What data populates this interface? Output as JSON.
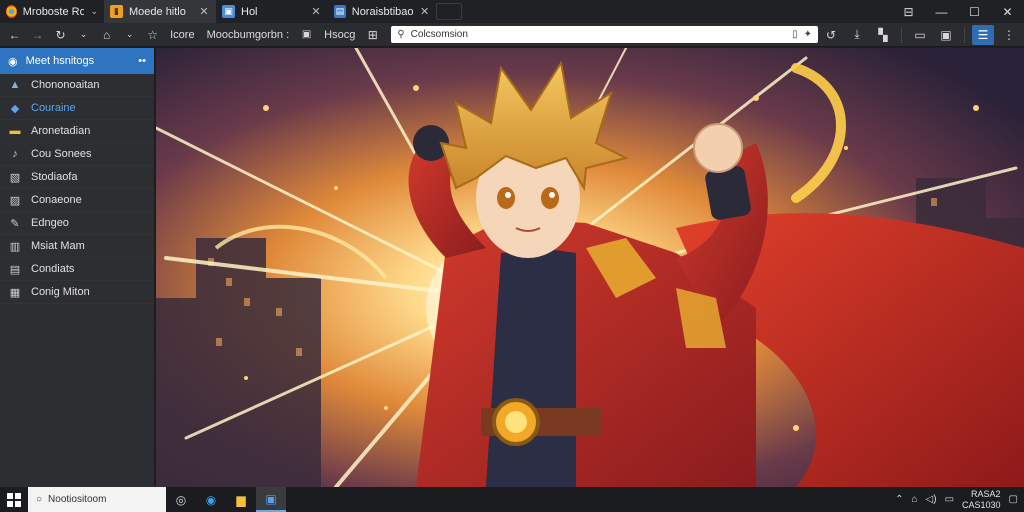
{
  "tabs": [
    {
      "title": "Mroboste Rosa",
      "icon": "browser-logo-icon",
      "active": false
    },
    {
      "title": "Moede hitlo",
      "icon": "folder-icon",
      "active": true
    },
    {
      "title": "Hol",
      "icon": "image-icon",
      "active": false
    },
    {
      "title": "Noraisbtibaon",
      "icon": "page-icon",
      "active": false
    }
  ],
  "window_controls": {
    "tabs_icon": "tab-search-icon",
    "minimize": "—",
    "maximize": "☐",
    "close": "✕"
  },
  "nav": {
    "home_label": "Icore",
    "breadcrumb_label": "Moocbumgorbn :",
    "reader_label": "Hsocg",
    "address_text": "Colcsomsion",
    "icons": [
      "back-icon",
      "forward-icon",
      "refresh-icon",
      "home-icon",
      "bookmark-icon",
      "apps-icon",
      "lock-icon",
      "extension-icon"
    ]
  },
  "sidebar": {
    "header": "Meet hsnitogs",
    "more": "••",
    "items": [
      {
        "label": "Chononoaitan",
        "icon": "photo-icon",
        "selected": false
      },
      {
        "label": "Couraine",
        "icon": "bookmark-blue-icon",
        "selected": true
      },
      {
        "label": "Aronetadian",
        "icon": "folder-yellow-icon",
        "selected": false
      },
      {
        "label": "Cou Sonees",
        "icon": "music-icon",
        "selected": false
      },
      {
        "label": "Stodiaofa",
        "icon": "album-icon",
        "selected": false
      },
      {
        "label": "Conaeone",
        "icon": "document-icon",
        "selected": false
      },
      {
        "label": "Edngeo",
        "icon": "edit-icon",
        "selected": false
      },
      {
        "label": "Msiat Mam",
        "icon": "book-icon",
        "selected": false
      },
      {
        "label": "Condiats",
        "icon": "page-icon",
        "selected": false
      },
      {
        "label": "Conig Miton",
        "icon": "settings-card-icon",
        "selected": false
      }
    ]
  },
  "taskbar": {
    "search_placeholder": "Nootiositoom",
    "clock_time": "RASA2",
    "clock_date": "CAS1030",
    "tray_icons": [
      "chevron-up-icon",
      "network-icon",
      "speaker-icon",
      "notification-icon"
    ]
  },
  "colors": {
    "accent": "#2f74c0",
    "selected_text": "#5ea4ee",
    "tab_bg": "#202124",
    "sidebar_bg": "#2d2e31"
  }
}
